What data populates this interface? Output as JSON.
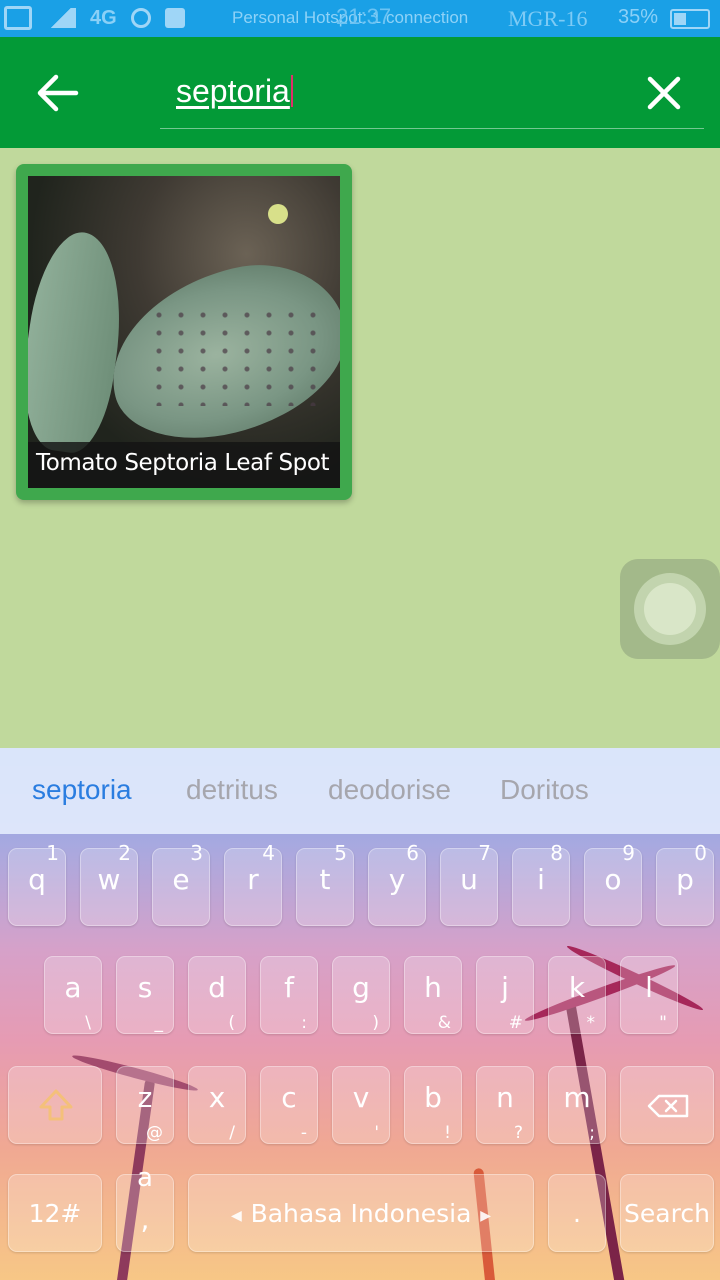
{
  "status_bar": {
    "network": "4G",
    "hotspot_text": "Personal Hotspot: 1 connection",
    "time": "21:37",
    "carrier": "MGR-16",
    "battery": "35%"
  },
  "toolbar": {
    "search_query": "septoria"
  },
  "results": [
    {
      "title": "Tomato Septoria Leaf Spot"
    }
  ],
  "keyboard": {
    "suggestions": [
      "septoria",
      "detritus",
      "deodorise",
      "Doritos"
    ],
    "row1": [
      {
        "key": "q",
        "hint": "1"
      },
      {
        "key": "w",
        "hint": "2"
      },
      {
        "key": "e",
        "hint": "3"
      },
      {
        "key": "r",
        "hint": "4"
      },
      {
        "key": "t",
        "hint": "5"
      },
      {
        "key": "y",
        "hint": "6"
      },
      {
        "key": "u",
        "hint": "7"
      },
      {
        "key": "i",
        "hint": "8"
      },
      {
        "key": "o",
        "hint": "9"
      },
      {
        "key": "p",
        "hint": "0"
      }
    ],
    "row2": [
      {
        "key": "a",
        "sub": "\\"
      },
      {
        "key": "s",
        "sub": "_"
      },
      {
        "key": "d",
        "sub": "("
      },
      {
        "key": "f",
        "sub": ":"
      },
      {
        "key": "g",
        "sub": ")"
      },
      {
        "key": "h",
        "sub": "&"
      },
      {
        "key": "j",
        "sub": "#"
      },
      {
        "key": "k",
        "sub": "*"
      },
      {
        "key": "l",
        "sub": "\""
      }
    ],
    "row3": [
      {
        "key": "z",
        "sub": "@"
      },
      {
        "key": "x",
        "sub": "/"
      },
      {
        "key": "c",
        "sub": "-"
      },
      {
        "key": "v",
        "sub": "'"
      },
      {
        "key": "b",
        "sub": "!"
      },
      {
        "key": "n",
        "sub": "?"
      },
      {
        "key": "m",
        "sub": ";"
      }
    ],
    "symbols_label": "12#",
    "comma_key": ",",
    "comma_hint": "a",
    "space_label": "Bahasa Indonesia",
    "period_label": ".",
    "search_label": "Search"
  }
}
